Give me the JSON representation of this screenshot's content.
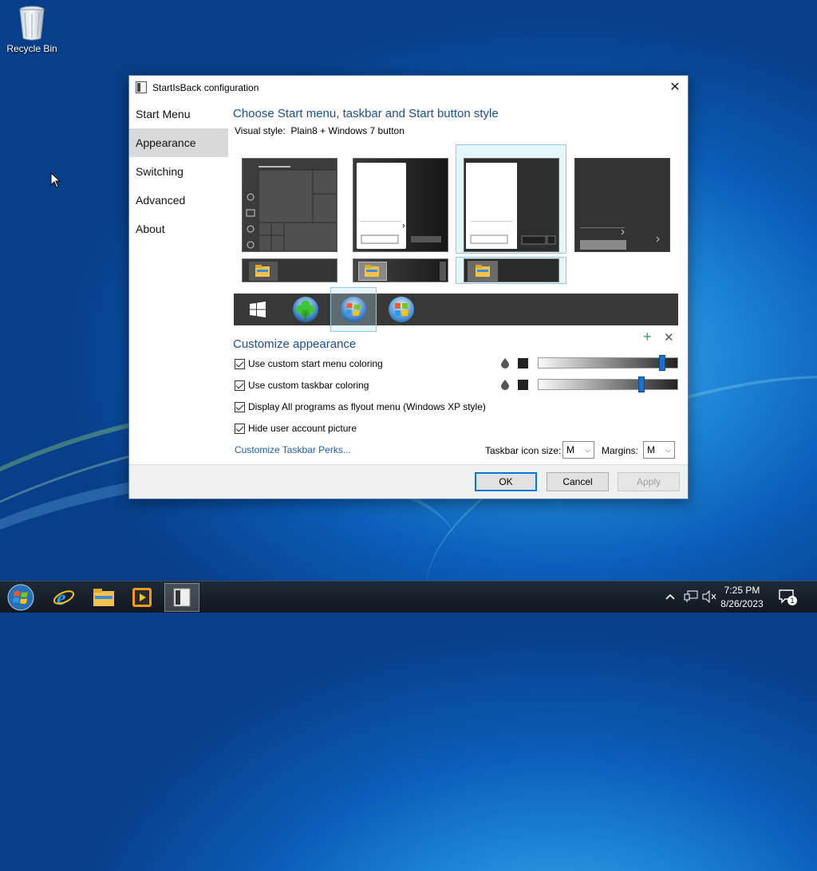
{
  "desktop": {
    "recycle_bin_label": "Recycle Bin"
  },
  "window": {
    "title": "StartIsBack configuration",
    "close_glyph": "✕",
    "sidebar": [
      {
        "label": "Start Menu",
        "selected": false
      },
      {
        "label": "Appearance",
        "selected": true
      },
      {
        "label": "Switching",
        "selected": false
      },
      {
        "label": "Advanced",
        "selected": false
      },
      {
        "label": "About",
        "selected": false
      }
    ],
    "heading": "Choose Start menu, taskbar and Start button style",
    "visual_style_label": "Visual style:",
    "visual_style_value": "Plain8 + Windows 7 button",
    "customize_heading": "Customize appearance",
    "add_glyph": "+",
    "remove_glyph": "✕",
    "checkboxes": [
      {
        "label": "Use custom start menu coloring",
        "checked": true
      },
      {
        "label": "Use custom taskbar coloring",
        "checked": true
      },
      {
        "label": "Display All programs as flyout menu (Windows XP style)",
        "checked": true
      },
      {
        "label": "Hide user account picture",
        "checked": true
      }
    ],
    "sliders": [
      {
        "name": "start-menu-opacity",
        "value": 0.91
      },
      {
        "name": "taskbar-opacity",
        "value": 0.75
      }
    ],
    "taskbar_perks_link": "Customize Taskbar Perks...",
    "taskbar_icon_size_label": "Taskbar icon size:",
    "taskbar_icon_size_value": "M",
    "margins_label": "Margins:",
    "margins_value": "M",
    "buttons": {
      "ok": "OK",
      "cancel": "Cancel",
      "apply": "Apply"
    }
  },
  "taskbar": {
    "items": [
      "start-orb",
      "internet-explorer",
      "file-explorer",
      "media-player",
      "startisback-config"
    ],
    "active_item": "startisback-config",
    "clock_time": "7:25 PM",
    "clock_date": "8/26/2023",
    "notification_count": "1"
  },
  "colors": {
    "accent": "#0078d7",
    "heading": "#1a4e92",
    "link": "#1a5fa8",
    "slider_knob": "#1e6fc8"
  }
}
